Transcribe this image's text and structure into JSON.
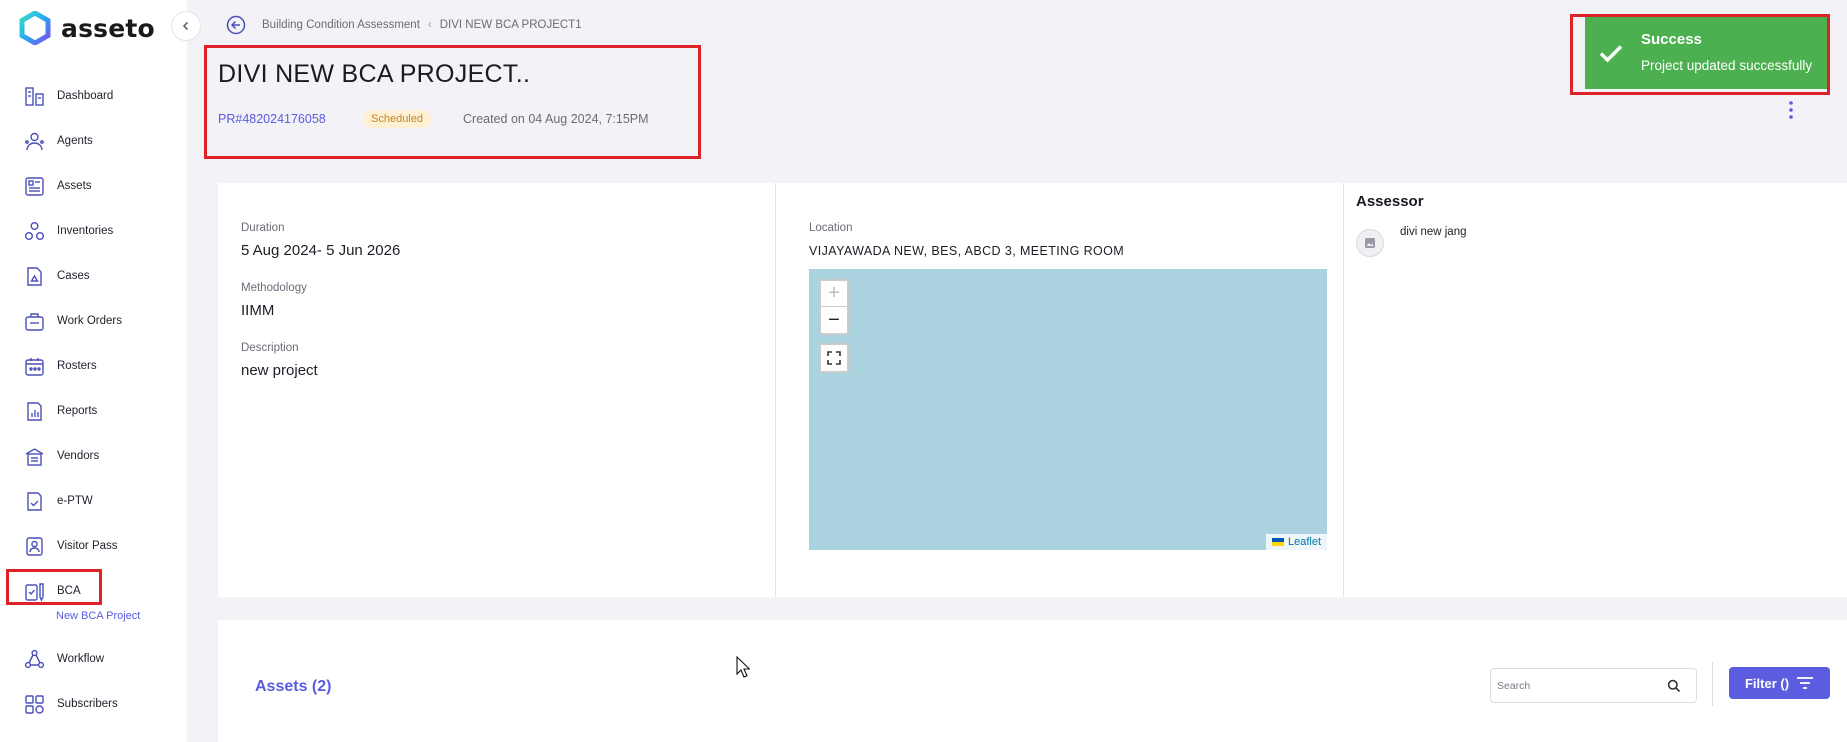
{
  "app": {
    "logo_text": "asseto"
  },
  "sidebar": {
    "items": [
      {
        "label": "Dashboard",
        "icon": "dashboard-icon"
      },
      {
        "label": "Agents",
        "icon": "agents-icon"
      },
      {
        "label": "Assets",
        "icon": "assets-icon"
      },
      {
        "label": "Inventories",
        "icon": "inventories-icon"
      },
      {
        "label": "Cases",
        "icon": "cases-icon"
      },
      {
        "label": "Work Orders",
        "icon": "work-orders-icon"
      },
      {
        "label": "Rosters",
        "icon": "rosters-icon"
      },
      {
        "label": "Reports",
        "icon": "reports-icon"
      },
      {
        "label": "Vendors",
        "icon": "vendors-icon"
      },
      {
        "label": "e-PTW",
        "icon": "eptw-icon"
      },
      {
        "label": "Visitor Pass",
        "icon": "visitor-pass-icon"
      },
      {
        "label": "BCA",
        "icon": "bca-icon"
      },
      {
        "label": "Workflow",
        "icon": "workflow-icon"
      },
      {
        "label": "Subscribers",
        "icon": "subscribers-icon"
      }
    ],
    "sub_item": "New BCA Project"
  },
  "breadcrumb": {
    "parent": "Building Condition Assessment",
    "current": "DIVI NEW BCA PROJECT1"
  },
  "project": {
    "title": "DIVI NEW BCA PROJECT..",
    "id": "PR#482024176058",
    "status": "Scheduled",
    "created": "Created on 04 Aug 2024, 7:15PM"
  },
  "toast": {
    "title": "Success",
    "message": "Project updated successfully"
  },
  "details": {
    "duration_label": "Duration",
    "duration_value": "5 Aug 2024- 5 Jun 2026",
    "methodology_label": "Methodology",
    "methodology_value": "IIMM",
    "description_label": "Description",
    "description_value": "new project",
    "location_label": "Location",
    "location_value": "VIJAYAWADA NEW, BES, ABCD 3, MEETING ROOM"
  },
  "map": {
    "zoom_in": "+",
    "zoom_out": "−",
    "attribution": "Leaflet"
  },
  "assessor": {
    "title": "Assessor",
    "name": "divi new jang"
  },
  "assets": {
    "title": "Assets (2)",
    "search_placeholder": "Search",
    "filter_label": "Filter ()"
  },
  "colors": {
    "accent": "#5b5ce0",
    "success": "#4caf50",
    "highlight": "#dd2228",
    "badge_bg": "#fdf0d5"
  }
}
